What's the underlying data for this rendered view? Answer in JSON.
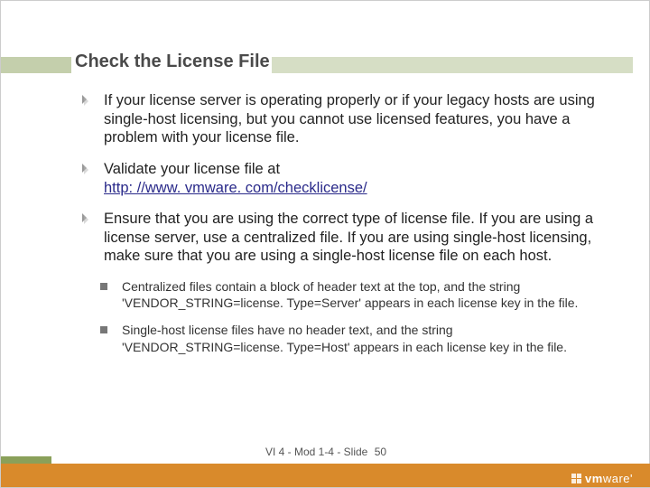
{
  "title": "Check the License File",
  "bullets_l1": [
    {
      "text": "If your license server is operating properly or if your legacy hosts are using single-host licensing, but you cannot use licensed features, you have a problem with your license file."
    },
    {
      "text_pre": "Validate your license file at ",
      "link": "http: //www. vmware. com/checklicense/"
    },
    {
      "text": "Ensure that you are using the correct type of license file. If you are using a license server, use a centralized file. If you are using single-host licensing, make sure that you are using a single-host license file on each host."
    }
  ],
  "bullets_l2": [
    {
      "text": "Centralized files contain a block of header text at the top, and the string 'VENDOR_STRING=license. Type=Server' appears in each license key in the file."
    },
    {
      "text": "Single-host license files have no header text, and the string 'VENDOR_STRING=license. Type=Host' appears in each license key in the file."
    }
  ],
  "footer": {
    "label": "VI 4 - Mod 1-4 - Slide",
    "number": "50"
  },
  "logo": {
    "brand_prefix": "vm",
    "brand_suffix": "ware"
  }
}
